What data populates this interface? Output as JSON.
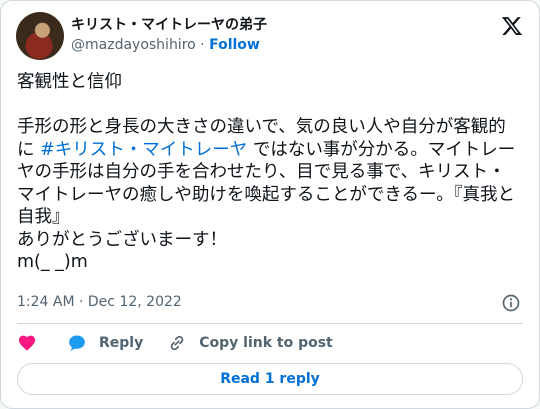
{
  "author": {
    "display_name": "キリスト・マイトレーヤの弟子",
    "handle": "@mazdayoshihiro",
    "separator": "·",
    "follow_label": "Follow"
  },
  "tweet": {
    "text_before": "客観性と信仰\n\n手形の形と身長の大きさの違いで、気の良い人や自分が客観的に ",
    "hashtag": "#キリスト・マイトレーヤ",
    "text_after": " ではない事が分かる。マイトレーヤの手形は自分の手を合わせたり、目で見る事で、キリスト・マイトレーヤの癒しや助けを喚起することができるー。『真我と自我』\nありがとうございまーす！\nm(_ _)m",
    "time": "1:24 AM",
    "separator": "·",
    "date": "Dec 12, 2022"
  },
  "actions": {
    "reply_label": "Reply",
    "copy_link_label": "Copy link to post",
    "read_replies_label": "Read 1 reply"
  },
  "icons": {
    "logo": "x-logo-icon",
    "info": "info-icon",
    "like": "heart-icon",
    "reply": "speech-bubble-icon",
    "copy": "link-icon"
  },
  "colors": {
    "link": "#006fd6",
    "like": "#f91880",
    "reply": "#1d9bf0",
    "muted": "#536471",
    "border": "#cfd9de"
  }
}
